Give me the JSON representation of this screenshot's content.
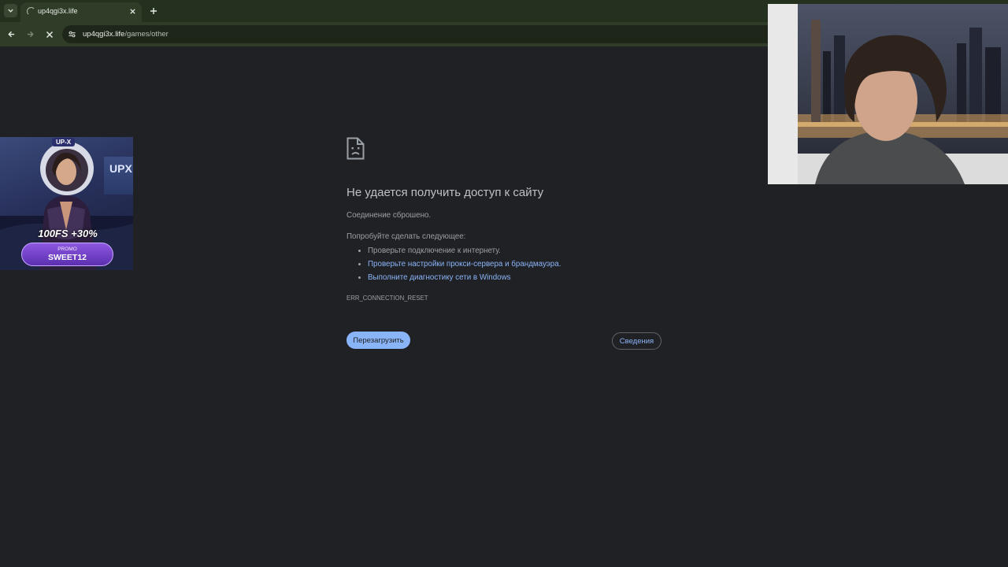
{
  "browser": {
    "tab": {
      "title": "up4qgi3x.life"
    },
    "url": {
      "host": "up4qgi3x.life",
      "path": "/games/other"
    }
  },
  "error_page": {
    "title": "Не удается получить доступ к сайту",
    "subtitle": "Соединение сброшено.",
    "try_label": "Попробуйте сделать следующее:",
    "suggestions": [
      "Проверьте подключение к интернету.",
      "Проверьте настройки прокси-сервера и брандмауэра.",
      "Выполните диагностику сети в Windows"
    ],
    "error_code": "ERR_CONNECTION_RESET",
    "reload_button": "Перезагрузить",
    "details_button": "Сведения"
  },
  "promo_banner": {
    "brand": "UP-X",
    "flag_text": "UPX",
    "headline": "100FS +30%",
    "code_label": "PROMO",
    "code": "SWEET12"
  },
  "webcam": {
    "icon": "person-webcam-feed"
  },
  "colors": {
    "page_background": "#202124",
    "link": "#8ab4f8",
    "chrome_frame": "#2f3c28"
  }
}
